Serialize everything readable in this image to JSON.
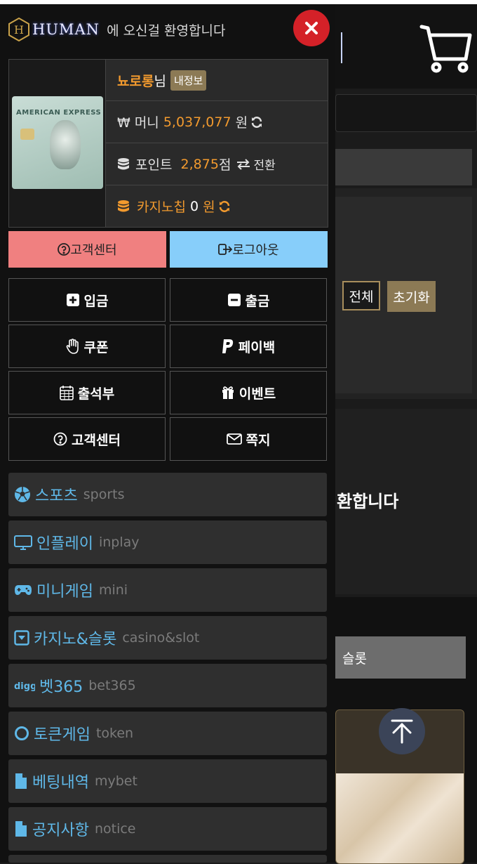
{
  "brand": {
    "name": "HUMAN",
    "welcome": "에 오신걸 환영합니다"
  },
  "user": {
    "nickname": "뇨로롱",
    "suffix": "님",
    "profile_btn": "내정보"
  },
  "wallet": {
    "money_label": "₩ 머니",
    "money_value": "5,037,077",
    "money_unit": "원",
    "point_label": "포인트",
    "point_value": "2,875",
    "point_unit": "점",
    "exchange_label": "전환",
    "casino_label": "카지노칩",
    "casino_value": "0",
    "casino_unit": "원"
  },
  "actions": {
    "support": "고객센터",
    "logout": "로그아웃"
  },
  "grid": [
    {
      "label": "입금",
      "icon": "plus-square-icon"
    },
    {
      "label": "출금",
      "icon": "minus-square-icon"
    },
    {
      "label": "쿠폰",
      "icon": "hand-icon"
    },
    {
      "label": "페이백",
      "icon": "paypal-icon"
    },
    {
      "label": "출석부",
      "icon": "calendar-icon"
    },
    {
      "label": "이벤트",
      "icon": "gift-icon"
    },
    {
      "label": "고객센터",
      "icon": "question-circle-icon"
    },
    {
      "label": "쪽지",
      "icon": "envelope-icon"
    }
  ],
  "nav": [
    {
      "label": "스포츠",
      "sub": "sports",
      "icon": "soccer-ball-icon"
    },
    {
      "label": "인플레이",
      "sub": "inplay",
      "icon": "monitor-icon"
    },
    {
      "label": "미니게임",
      "sub": "mini",
      "icon": "gamepad-icon"
    },
    {
      "label": "카지노&슬롯",
      "sub": "casino&slot",
      "icon": "caret-square-icon"
    },
    {
      "label": "벳365",
      "sub": "bet365",
      "icon": "digg-icon"
    },
    {
      "label": "토큰게임",
      "sub": "token",
      "icon": "circle-icon"
    },
    {
      "label": "베팅내역",
      "sub": "mybet",
      "icon": "file-icon"
    },
    {
      "label": "공지사항",
      "sub": "notice",
      "icon": "file-icon"
    }
  ],
  "background": {
    "filter_all": "전체",
    "filter_reset": "초기화",
    "welcome_fragment": "환합니다",
    "slot_tab": "슬롯"
  },
  "colors": {
    "accent_orange": "#f29a2e",
    "support_btn": "#f08080",
    "logout_btn": "#87cefa",
    "nav_text": "#5fb8e8",
    "close_red": "#d42128"
  }
}
